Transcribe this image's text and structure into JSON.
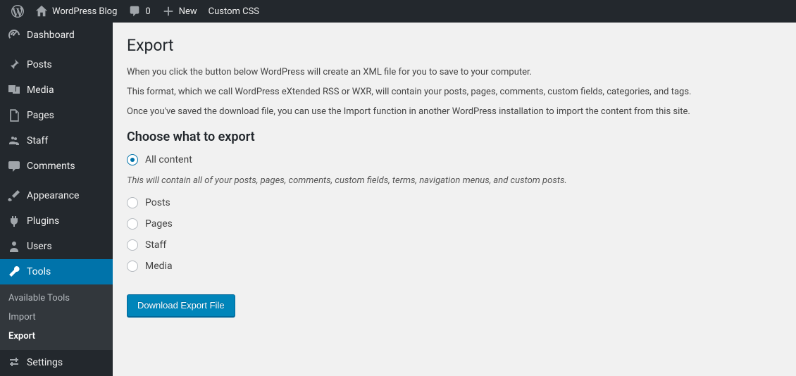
{
  "adminbar": {
    "site_name": "WordPress Blog",
    "comments_count": "0",
    "new_label": "New",
    "custom_css_label": "Custom CSS"
  },
  "sidebar": {
    "items": [
      {
        "label": "Dashboard",
        "icon": "dashboard"
      },
      {
        "label": "Posts",
        "icon": "pin"
      },
      {
        "label": "Media",
        "icon": "media"
      },
      {
        "label": "Pages",
        "icon": "page"
      },
      {
        "label": "Staff",
        "icon": "staff"
      },
      {
        "label": "Comments",
        "icon": "comment"
      },
      {
        "label": "Appearance",
        "icon": "appearance"
      },
      {
        "label": "Plugins",
        "icon": "plugin"
      },
      {
        "label": "Users",
        "icon": "user"
      },
      {
        "label": "Tools",
        "icon": "tools"
      },
      {
        "label": "Settings",
        "icon": "settings"
      }
    ],
    "submenu": {
      "items": [
        {
          "label": "Available Tools"
        },
        {
          "label": "Import"
        },
        {
          "label": "Export"
        }
      ]
    }
  },
  "main": {
    "title": "Export",
    "intro1": "When you click the button below WordPress will create an XML file for you to save to your computer.",
    "intro2": "This format, which we call WordPress eXtended RSS or WXR, will contain your posts, pages, comments, custom fields, categories, and tags.",
    "intro3": "Once you've saved the download file, you can use the Import function in another WordPress installation to import the content from this site.",
    "subhead": "Choose what to export",
    "options": [
      {
        "label": "All content",
        "checked": true
      },
      {
        "label": "Posts",
        "checked": false
      },
      {
        "label": "Pages",
        "checked": false
      },
      {
        "label": "Staff",
        "checked": false
      },
      {
        "label": "Media",
        "checked": false
      }
    ],
    "all_content_desc": "This will contain all of your posts, pages, comments, custom fields, terms, navigation menus, and custom posts.",
    "button_label": "Download Export File"
  }
}
